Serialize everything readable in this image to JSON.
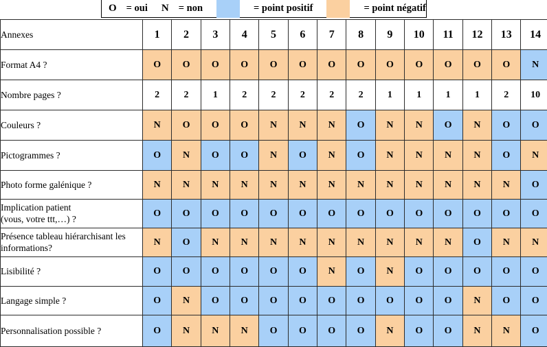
{
  "legend": {
    "oui_symbol": "O",
    "oui_text": "= oui",
    "non_symbol": "N",
    "non_text": "= non",
    "positive_text": "= point positif",
    "negative_text": "= point négatif",
    "positive_color": "#a8d0f8",
    "negative_color": "#fbd0a0"
  },
  "table": {
    "corner_label": "Annexes",
    "columns": [
      "1",
      "2",
      "3",
      "4",
      "5",
      "6",
      "7",
      "8",
      "9",
      "10",
      "11",
      "12",
      "13",
      "14"
    ],
    "rows": [
      {
        "label": "Format A4 ?",
        "values": [
          "O",
          "O",
          "O",
          "O",
          "O",
          "O",
          "O",
          "O",
          "O",
          "O",
          "O",
          "O",
          "O",
          "N"
        ],
        "colors": [
          "neg",
          "neg",
          "neg",
          "neg",
          "neg",
          "neg",
          "neg",
          "neg",
          "neg",
          "neg",
          "neg",
          "neg",
          "neg",
          "pos"
        ]
      },
      {
        "label": "Nombre pages ?",
        "values": [
          "2",
          "2",
          "1",
          "2",
          "2",
          "2",
          "2",
          "2",
          "1",
          "1",
          "1",
          "1",
          "2",
          "10"
        ],
        "colors": [
          "none",
          "none",
          "none",
          "none",
          "none",
          "none",
          "none",
          "none",
          "none",
          "none",
          "none",
          "none",
          "none",
          "none"
        ]
      },
      {
        "label": "Couleurs ?",
        "values": [
          "N",
          "O",
          "O",
          "O",
          "N",
          "N",
          "N",
          "O",
          "N",
          "N",
          "O",
          "N",
          "O",
          "O"
        ],
        "colors": [
          "neg",
          "neg",
          "neg",
          "neg",
          "neg",
          "neg",
          "neg",
          "pos",
          "neg",
          "neg",
          "pos",
          "neg",
          "pos",
          "pos"
        ]
      },
      {
        "label": "Pictogrammes ?",
        "values": [
          "O",
          "N",
          "O",
          "O",
          "N",
          "O",
          "N",
          "O",
          "N",
          "N",
          "N",
          "N",
          "O",
          "N"
        ],
        "colors": [
          "pos",
          "neg",
          "pos",
          "pos",
          "neg",
          "pos",
          "neg",
          "pos",
          "neg",
          "neg",
          "neg",
          "neg",
          "pos",
          "neg"
        ]
      },
      {
        "label": "Photo forme galénique ?",
        "values": [
          "N",
          "N",
          "N",
          "N",
          "N",
          "N",
          "N",
          "N",
          "N",
          "N",
          "N",
          "N",
          "N",
          "O"
        ],
        "colors": [
          "neg",
          "neg",
          "neg",
          "neg",
          "neg",
          "neg",
          "neg",
          "neg",
          "neg",
          "neg",
          "neg",
          "neg",
          "neg",
          "pos"
        ]
      },
      {
        "label": "Implication patient\n(vous, votre ttt,…) ?",
        "label_line1": "Implication patient",
        "label_line2": "(vous, votre ttt,…) ?",
        "values": [
          "O",
          "O",
          "O",
          "O",
          "O",
          "O",
          "O",
          "O",
          "O",
          "O",
          "O",
          "O",
          "O",
          "O"
        ],
        "colors": [
          "pos",
          "pos",
          "pos",
          "pos",
          "pos",
          "pos",
          "pos",
          "pos",
          "pos",
          "pos",
          "pos",
          "pos",
          "pos",
          "pos"
        ]
      },
      {
        "label": "Présence tableau hiérarchisant les informations?",
        "label_line1": "Présence tableau hiérarchisant les",
        "label_line2": "informations?",
        "values": [
          "N",
          "O",
          "N",
          "N",
          "N",
          "N",
          "N",
          "N",
          "N",
          "N",
          "N",
          "O",
          "N",
          "N"
        ],
        "colors": [
          "neg",
          "pos",
          "neg",
          "neg",
          "neg",
          "neg",
          "neg",
          "neg",
          "neg",
          "neg",
          "neg",
          "pos",
          "neg",
          "neg"
        ]
      },
      {
        "label": "Lisibilité ?",
        "values": [
          "O",
          "O",
          "O",
          "O",
          "O",
          "O",
          "N",
          "O",
          "N",
          "O",
          "O",
          "O",
          "O",
          "O"
        ],
        "colors": [
          "pos",
          "pos",
          "pos",
          "pos",
          "pos",
          "pos",
          "neg",
          "pos",
          "neg",
          "pos",
          "pos",
          "pos",
          "pos",
          "pos"
        ]
      },
      {
        "label": "Langage simple ?",
        "values": [
          "O",
          "N",
          "O",
          "O",
          "O",
          "O",
          "O",
          "O",
          "O",
          "O",
          "O",
          "N",
          "O",
          "O"
        ],
        "colors": [
          "pos",
          "neg",
          "pos",
          "pos",
          "pos",
          "pos",
          "pos",
          "pos",
          "pos",
          "pos",
          "pos",
          "neg",
          "pos",
          "pos"
        ]
      },
      {
        "label": "Personnalisation possible ?",
        "values": [
          "O",
          "N",
          "N",
          "N",
          "O",
          "O",
          "O",
          "O",
          "N",
          "O",
          "O",
          "N",
          "N",
          "O"
        ],
        "colors": [
          "pos",
          "neg",
          "neg",
          "neg",
          "pos",
          "pos",
          "pos",
          "pos",
          "neg",
          "pos",
          "pos",
          "neg",
          "neg",
          "pos"
        ]
      }
    ]
  }
}
